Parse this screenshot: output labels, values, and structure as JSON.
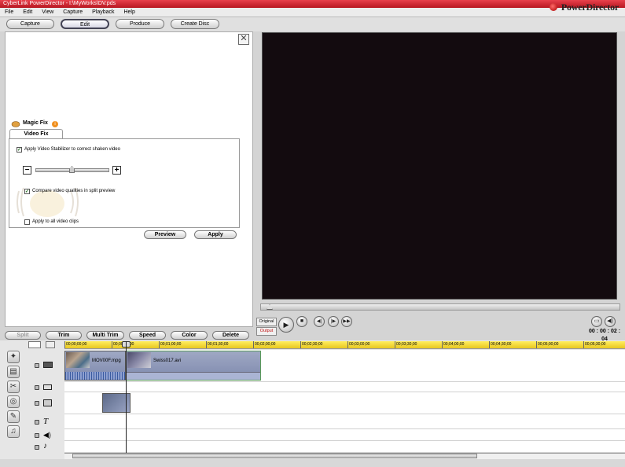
{
  "window": {
    "title": "CyberLink PowerDirector - I:\\MyWorks\\DV.pds"
  },
  "menu": [
    "File",
    "Edit",
    "View",
    "Capture",
    "Playback",
    "Help"
  ],
  "modes": [
    {
      "label": "Capture",
      "active": false
    },
    {
      "label": "Edit",
      "active": true
    },
    {
      "label": "Produce",
      "active": false
    },
    {
      "label": "Create Disc",
      "active": false
    }
  ],
  "brand": {
    "name": "PowerDirector"
  },
  "panel": {
    "close_symbol": "✕",
    "title": "Magic Fix",
    "tab": "Video Fix",
    "stabilizer_label": "Apply Video Stabilizer to correct shaken video",
    "stabilizer_checked": true,
    "compare_label": "Compare video qualities in split preview",
    "compare_checked": true,
    "apply_all_label": "Apply to all video clips",
    "apply_all_checked": false,
    "minus": "−",
    "plus": "+",
    "preview_btn": "Preview",
    "apply_btn": "Apply"
  },
  "player": {
    "original_label": "Original",
    "output_label": "Output",
    "timecode": "00 : 00 : 02 : 04"
  },
  "editbar": [
    "Split",
    "Trim",
    "Multi Trim",
    "Speed",
    "Color",
    "Delete"
  ],
  "ruler": [
    "00;00;00;00",
    "00;00;30;00",
    "00;01;00;00",
    "00;01;30;00",
    "00;02;00;00",
    "00;02;30;00",
    "00;03;00;00",
    "00;03;30;00",
    "00;04;00;00",
    "00;04;30;00",
    "00;05;00;00",
    "00;05;30;00"
  ],
  "clips": [
    {
      "name": "MOV00F.mpg"
    },
    {
      "name": "Swiss017.avi"
    }
  ],
  "colors": {
    "accent": "#d4202c",
    "preview_bg": "#130b0f",
    "ruler": "#f0d830",
    "clip": "#8c96b8"
  }
}
